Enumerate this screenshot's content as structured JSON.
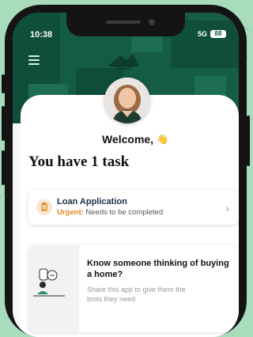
{
  "status_bar": {
    "time": "10:38",
    "network": "5G",
    "battery": "88"
  },
  "header": {
    "logo_name": "brand-logo"
  },
  "welcome": {
    "text": "Welcome,",
    "emoji": "👋"
  },
  "tasks": {
    "heading": "You have 1 task",
    "items": [
      {
        "title": "Loan Application",
        "urgent_label": "Urgent:",
        "status": "Needs to be completed"
      }
    ]
  },
  "referral": {
    "title": "Know someone thinking of buying a home?",
    "description": "Share this app to give them the tools they need"
  },
  "colors": {
    "background": "#a8dcbd",
    "header": "#155c46",
    "urgent": "#e08a1e"
  }
}
